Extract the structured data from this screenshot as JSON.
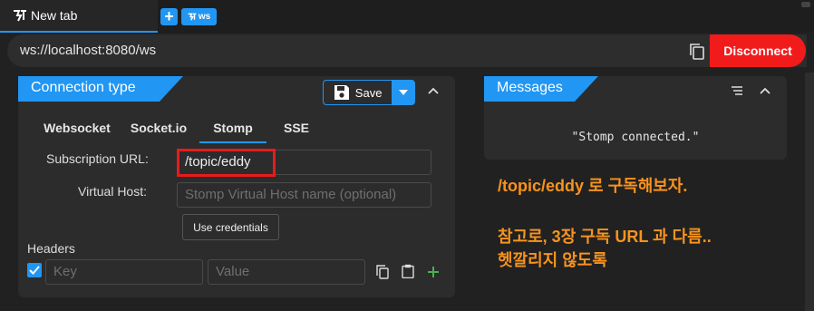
{
  "tabbar": {
    "tab_title": "New tab",
    "ws_badge": "ws",
    "add_icon": "plus-icon"
  },
  "urlbar": {
    "url": "ws://localhost:8080/ws",
    "disconnect_label": "Disconnect",
    "copy_icon": "copy-icon"
  },
  "connection": {
    "title": "Connection type",
    "save_label": "Save",
    "tabs": [
      {
        "label": "Websocket"
      },
      {
        "label": "Socket.io"
      },
      {
        "label": "Stomp"
      },
      {
        "label": "SSE"
      }
    ],
    "active_tab": "Stomp",
    "subscription_label": "Subscription URL:",
    "subscription_value": "/topic/eddy",
    "virtual_host_label": "Virtual Host:",
    "virtual_host_placeholder": "Stomp Virtual Host name (optional)",
    "credentials_label": "Use credentials",
    "headers_label": "Headers",
    "header_key_placeholder": "Key",
    "header_value_placeholder": "Value",
    "header_checked": true
  },
  "messages": {
    "title": "Messages",
    "items": [
      "\"Stomp connected.\""
    ]
  },
  "annotations": {
    "line1": "/topic/eddy 로 구독해보자.",
    "line2": "참고로, 3장 구독 URL 과 다름..",
    "line3": "헷깔리지 않도록"
  },
  "colors": {
    "accent": "#2196f3",
    "danger": "#f21b1b",
    "annotation": "#f7931e",
    "highlight": "#e81b1b"
  }
}
